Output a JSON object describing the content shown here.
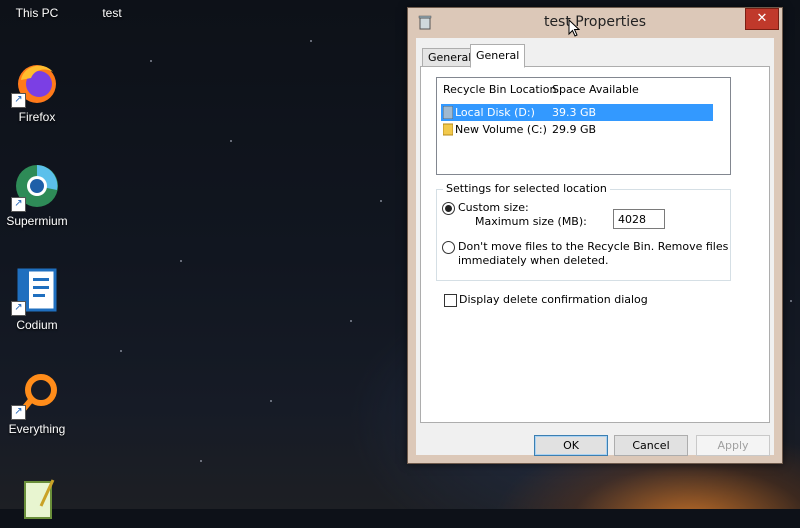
{
  "desktop": {
    "icons": [
      {
        "label": "This PC",
        "icon": "computer-icon"
      },
      {
        "label": "test",
        "icon": "folder-icon"
      },
      {
        "label": "Firefox",
        "icon": "firefox-icon"
      },
      {
        "label": "Supermium",
        "icon": "supermium-icon"
      },
      {
        "label": "Codium",
        "icon": "codium-icon"
      },
      {
        "label": "Everything",
        "icon": "everything-icon"
      }
    ]
  },
  "window": {
    "title": "test Properties",
    "close_label": "✕",
    "tabs": [
      {
        "label": "General",
        "active": false
      },
      {
        "label": "General",
        "active": true
      }
    ],
    "location_list": {
      "columns": [
        "Recycle Bin Location",
        "Space Available"
      ],
      "rows": [
        {
          "name": "Local Disk (D:)",
          "space": "39.3 GB",
          "selected": true
        },
        {
          "name": "New Volume (C:)",
          "space": "29.9 GB",
          "selected": false
        }
      ]
    },
    "settings": {
      "group_title": "Settings for selected location",
      "custom_size_label": "Custom size:",
      "max_size_label": "Maximum size (MB):",
      "max_size_value": "4028",
      "dont_move_label_line1": "Don't move files to the Recycle Bin. Remove files",
      "dont_move_label_line2": "immediately when deleted.",
      "custom_selected": true
    },
    "confirm_checkbox_label": "Display delete confirmation dialog",
    "buttons": {
      "ok": "OK",
      "cancel": "Cancel",
      "apply": "Apply"
    }
  },
  "colors": {
    "selection": "#3399ff",
    "close_button": "#c0392b",
    "window_frame": "#dcc8b8"
  }
}
